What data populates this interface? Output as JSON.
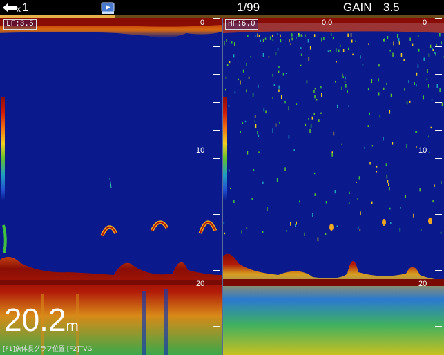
{
  "topbar": {
    "back_icon": "back-arrow-icon",
    "speed_prefix": "x",
    "speed_value": "1",
    "page": "1/99",
    "gain_label": "GAIN",
    "gain_value": "3.5",
    "playback_icon": "playback-icon",
    "progress_fraction": 0.26
  },
  "left_panel": {
    "freq_label": "LF:3.5",
    "scale": {
      "top": "0",
      "mid": "10",
      "bottom": "20"
    }
  },
  "right_panel": {
    "freq_label": "HF:6.0",
    "offset_label": "0.0",
    "scale": {
      "top": "0",
      "mid": "10",
      "bottom": "20"
    }
  },
  "depth": {
    "value": "20.2",
    "unit": "m"
  },
  "function_keys": {
    "text": "[F1]魚体長グラフ位置 [F2]TVG"
  },
  "colors": {
    "water_background": "#0a1a8c",
    "bottom_echo": "#8a0d05",
    "accent_orange": "#e6b14a"
  }
}
